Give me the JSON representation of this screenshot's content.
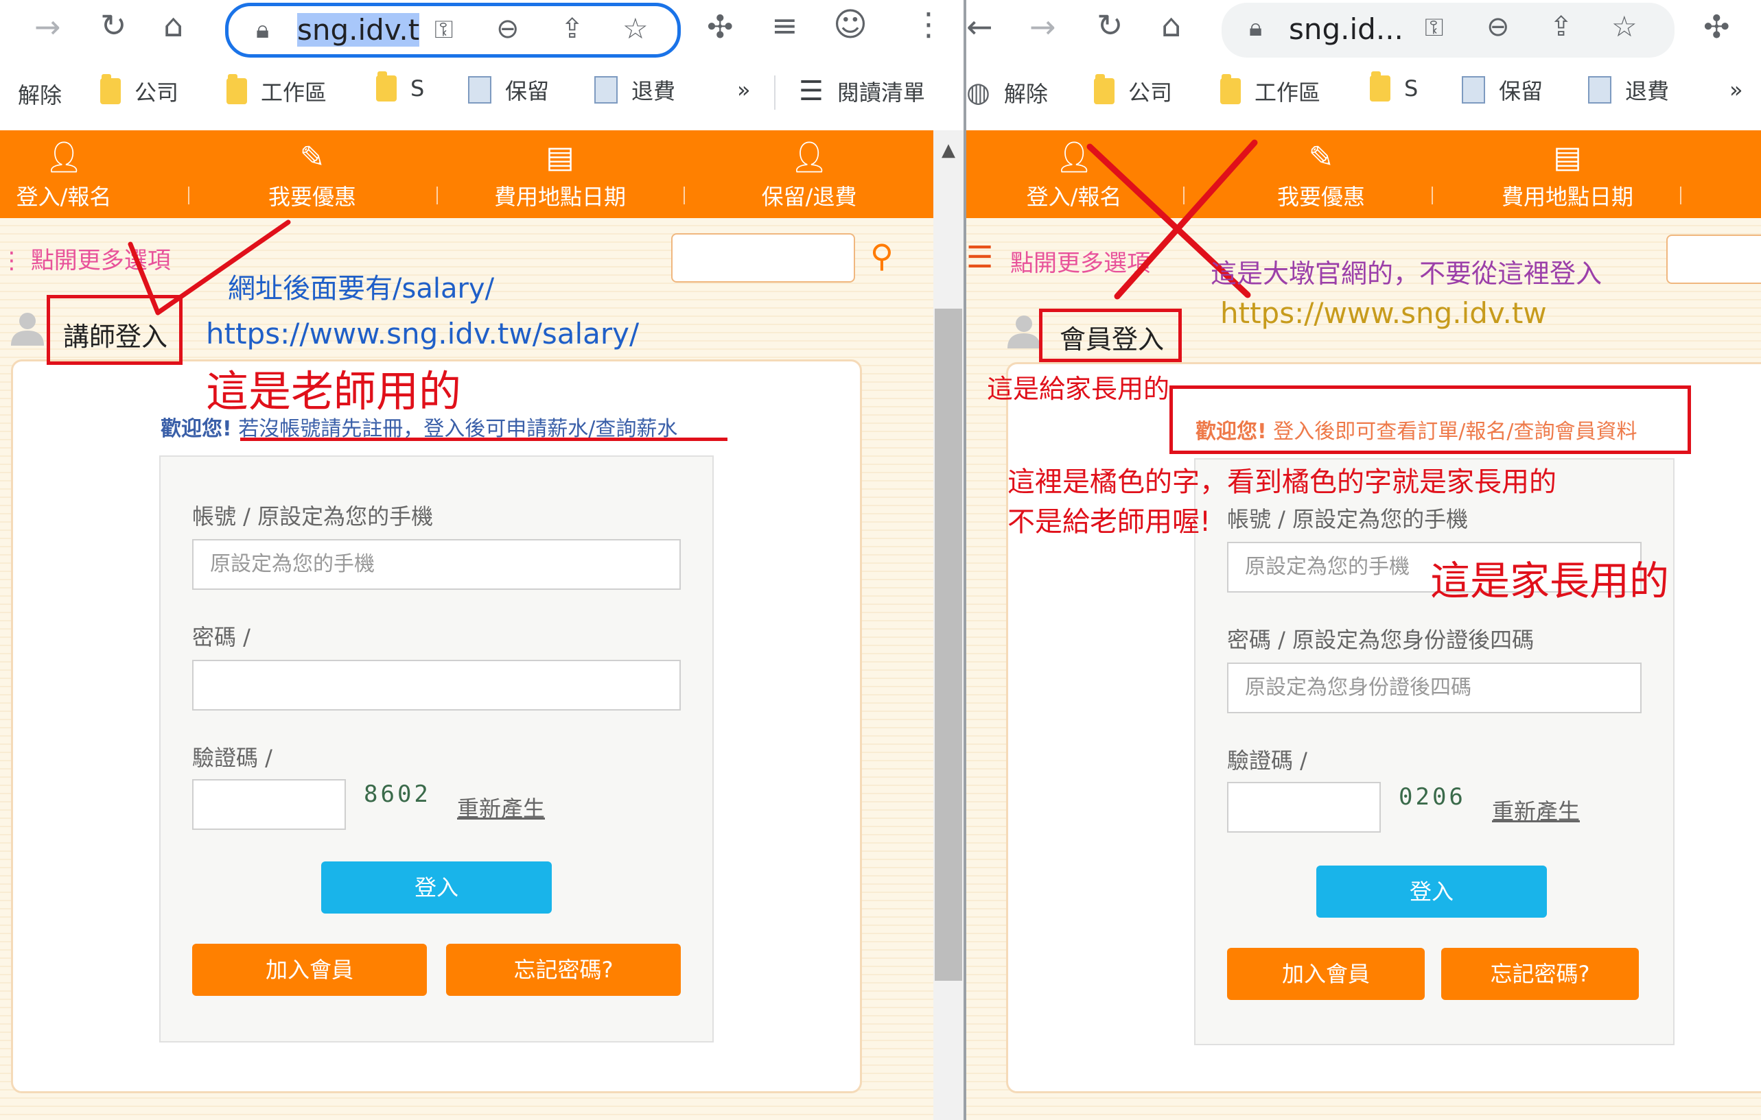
{
  "colors": {
    "nav_orange": "#ff8000",
    "login_blue": "#19b4ea",
    "annotation_red": "#e0101a",
    "annotation_blue": "#1f5fc8",
    "annotation_purple": "#9b3fa9",
    "annotation_olive": "#c79b1c",
    "menu_pink": "#e8529a"
  },
  "left": {
    "browser": {
      "url": "sng.idv.t",
      "bookmarks": [
        "解除",
        "公司",
        "工作區",
        "S",
        "保留",
        "退費"
      ],
      "overflow": "»",
      "reading_list": "閱讀清單"
    },
    "nav": [
      "登入/報名",
      "我要優惠",
      "費用地點日期",
      "保留/退費"
    ],
    "menu_link": "點開更多選項",
    "login_title": "講師登入",
    "welcome_bold": "歡迎您!",
    "welcome_text": "若沒帳號請先註冊，登入後可申請薪水/查詢薪水",
    "form": {
      "account_label": "帳號 / 原設定為您的手機",
      "account_placeholder": "原設定為您的手機",
      "password_label": "密碼 /",
      "captcha_label": "驗證碼 /",
      "captcha": "8602",
      "regen": "重新產生",
      "login": "登入",
      "join": "加入會員",
      "forgot": "忘記密碼?"
    },
    "annotations": {
      "url_note": "網址後面要有/salary/",
      "url": "https://www.sng.idv.tw/salary/",
      "teacher_note": "這是老師用的"
    }
  },
  "right": {
    "browser": {
      "url": "sng.id...",
      "bookmarks": [
        "解除",
        "公司",
        "工作區",
        "S",
        "保留",
        "退費"
      ],
      "overflow": "»"
    },
    "nav": [
      "登入/報名",
      "我要優惠",
      "費用地點日期"
    ],
    "menu_link": "點開更多選項",
    "login_title": "會員登入",
    "welcome_bold": "歡迎您!",
    "welcome_text": "登入後即可查看訂單/報名/查詢會員資料",
    "form": {
      "account_label": "帳號 / 原設定為您的手機",
      "account_placeholder": "原設定為您的手機",
      "password_label": "密碼 / 原設定為您身份證後四碼",
      "password_placeholder": "原設定為您身份證後四碼",
      "captcha_label": "驗證碼 /",
      "captcha": "0206",
      "regen": "重新產生",
      "login": "登入",
      "join": "加入會員",
      "forgot": "忘記密碼?"
    },
    "annotations": {
      "official_note": "這是大墩官網的，不要從這裡登入",
      "url": "https://www.sng.idv.tw",
      "parent_note_small": "這是給家長用的",
      "orange_note_1": "這裡是橘色的字，看到橘色的字就是家長用的",
      "orange_note_2": "不是給老師用喔!",
      "parent_note_big": "這是家長用的"
    }
  }
}
